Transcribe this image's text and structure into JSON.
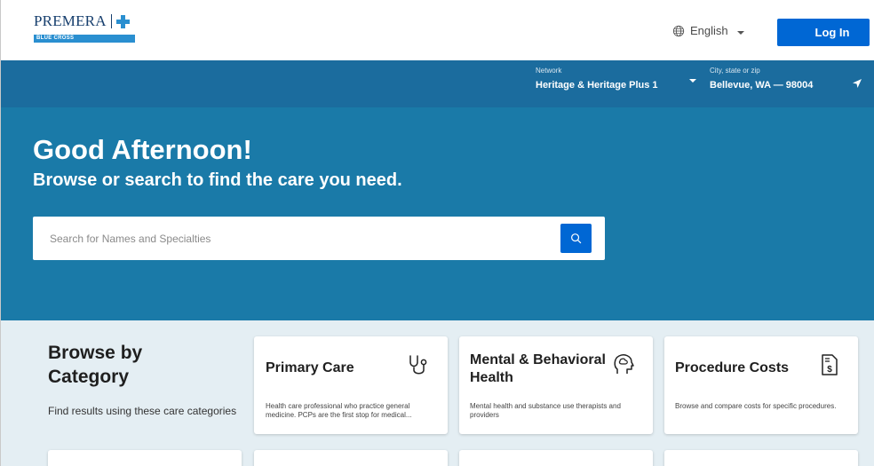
{
  "header": {
    "logo_word": "PREMERA",
    "logo_sub": "BLUE CROSS",
    "language": "English",
    "login_label": "Log In"
  },
  "filters": {
    "network_label": "Network",
    "network_value": "Heritage & Heritage Plus 1",
    "location_label": "City, state or zip",
    "location_value": "Bellevue, WA — 98004"
  },
  "hero": {
    "greeting": "Good Afternoon!",
    "subtitle": "Browse or search to find the care you need.",
    "search_placeholder": "Search for Names and Specialties"
  },
  "browse": {
    "title": "Browse by Category",
    "subtitle": "Find results using these care categories",
    "cards": [
      {
        "title": "Primary Care",
        "icon": "stethoscope-icon",
        "description": "Health care professional who practice general medicine. PCPs are the first stop for medical..."
      },
      {
        "title": "Mental & Behavioral Health",
        "icon": "brain-head-icon",
        "description": "Mental health and substance use therapists and providers"
      },
      {
        "title": "Procedure Costs",
        "icon": "cost-document-icon",
        "description": "Browse and compare costs for specific procedures."
      }
    ]
  },
  "colors": {
    "brand_blue": "#0067d4",
    "filter_bar": "#1b6c9e",
    "hero": "#1a7aa8",
    "browse_bg": "#e4eef3"
  }
}
